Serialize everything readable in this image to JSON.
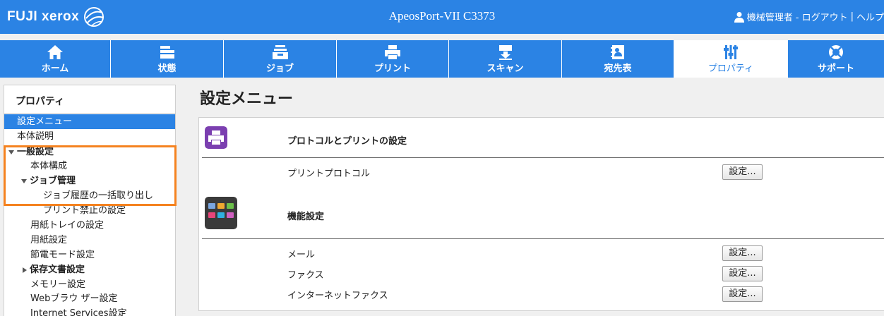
{
  "header": {
    "brand": "FUJI xerox",
    "product_title": "ApeosPort-VII C3373",
    "user_name": "機械管理者",
    "logout": " - ログアウト",
    "separator": "|",
    "help": "ヘルプ"
  },
  "tabs": [
    {
      "label": "ホーム",
      "icon": "home-icon"
    },
    {
      "label": "状態",
      "icon": "status-icon"
    },
    {
      "label": "ジョブ",
      "icon": "job-icon"
    },
    {
      "label": "プリント",
      "icon": "print-icon"
    },
    {
      "label": "スキャン",
      "icon": "scan-icon"
    },
    {
      "label": "宛先表",
      "icon": "address-book-icon"
    },
    {
      "label": "プロパティ",
      "icon": "properties-icon",
      "active": true
    },
    {
      "label": "サポート",
      "icon": "support-icon"
    }
  ],
  "sidebar": {
    "title": "プロパティ",
    "items": [
      {
        "label": "設定メニュー",
        "selected": true
      },
      {
        "label": "本体説明"
      },
      {
        "label": "一般設定",
        "bold": true,
        "expanded": true
      },
      {
        "label": "本体構成"
      },
      {
        "label": "ジョブ管理",
        "bold": true,
        "expanded": true
      },
      {
        "label": "ジョブ履歴の一括取り出し"
      },
      {
        "label": "プリント禁止の設定"
      },
      {
        "label": "用紙トレイの設定"
      },
      {
        "label": "用紙設定"
      },
      {
        "label": "節電モード設定"
      },
      {
        "label": "保存文書設定",
        "bold": true,
        "collapsed": true
      },
      {
        "label": "メモリー設定"
      },
      {
        "label": "Webブラウ ザー設定"
      },
      {
        "label": "Internet Services設定"
      }
    ]
  },
  "main": {
    "page_title": "設定メニュー",
    "sections": [
      {
        "title": "プロトコルとプリントの設定",
        "icon": "printer-settings-icon",
        "rows": [
          {
            "label": "プリントプロトコル",
            "button": "設定..."
          }
        ]
      },
      {
        "title": "機能設定",
        "icon": "function-settings-icon",
        "rows": [
          {
            "label": "メール",
            "button": "設定..."
          },
          {
            "label": "ファクス",
            "button": "設定..."
          },
          {
            "label": "インターネットファクス",
            "button": "設定..."
          }
        ]
      }
    ]
  },
  "colors": {
    "brand_blue": "#2b83e4",
    "highlight_orange": "#f5821f",
    "section_icon_purple": "#7b3fb0",
    "section_icon_dark": "#3a3a3a"
  }
}
